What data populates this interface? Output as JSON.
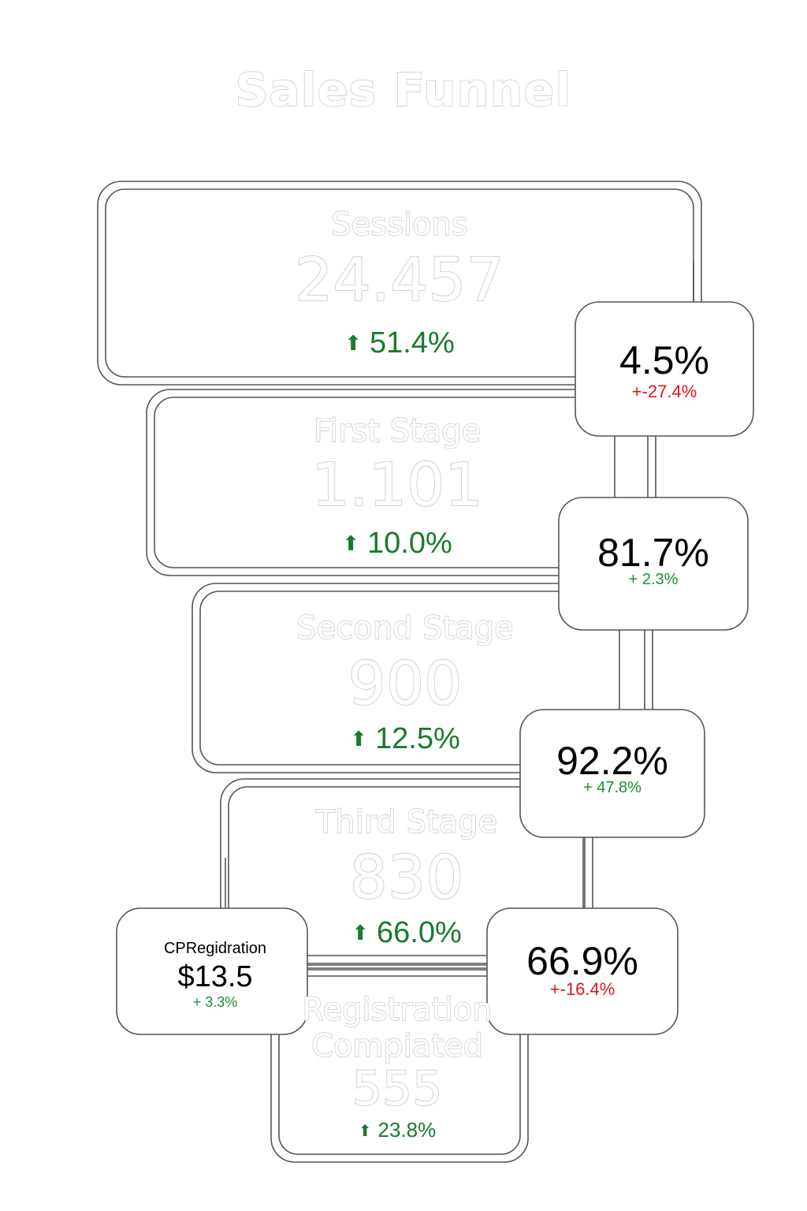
{
  "title": "Sales Funnel",
  "stages": [
    {
      "label": "Sessions",
      "value": "24.457",
      "delta": "51.4%"
    },
    {
      "label": "First Stage",
      "value": "1.101",
      "delta": "10.0%"
    },
    {
      "label": "Second Stage",
      "value": "900",
      "delta": "12.5%"
    },
    {
      "label": "Third Stage",
      "value": "830",
      "delta": "66.0%"
    },
    {
      "label_line1": "Registration",
      "label_line2": "Compiated",
      "value": "555",
      "delta": "23.8%"
    }
  ],
  "conversion_rates": [
    {
      "value": "4.5%",
      "change": "+-27.4%",
      "trend": "negative"
    },
    {
      "value": "81.7%",
      "change": "+ 2.3%",
      "trend": "positive"
    },
    {
      "value": "92.2%",
      "change": "+ 47.8%",
      "trend": "positive"
    },
    {
      "value": "66.9%",
      "change": "+-16.4%",
      "trend": "negative"
    }
  ],
  "cost_per_registration": {
    "label": "CPRegidration",
    "value": "$13.5",
    "change": "+ 3.3%",
    "trend": "positive"
  },
  "colors": {
    "outline": "#c8c8c8",
    "positive": "#1a7a2e",
    "negative": "#e0141e",
    "frame": "#555555"
  },
  "icons": {
    "delta": "up-arrow-icon"
  }
}
